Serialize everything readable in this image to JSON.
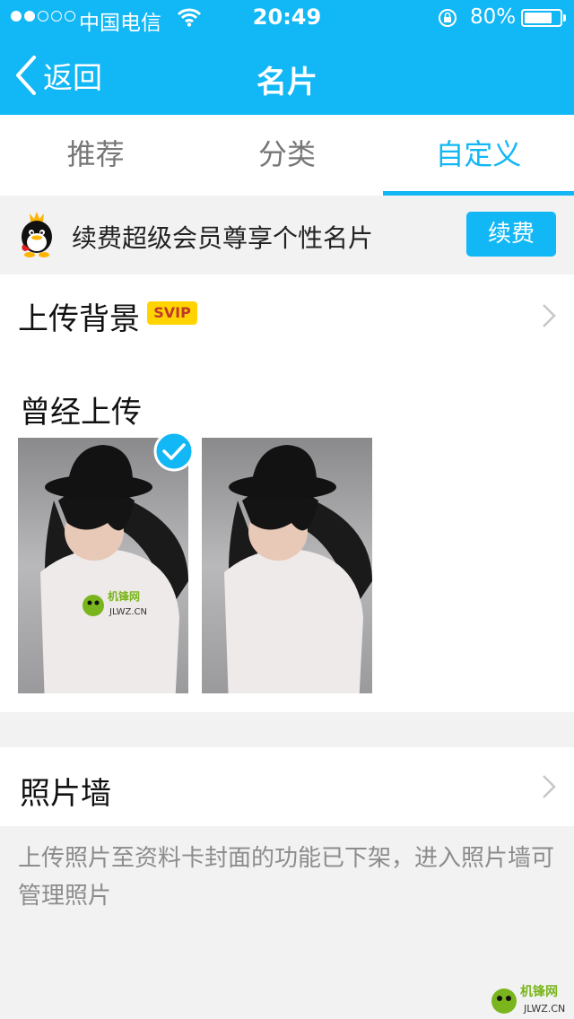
{
  "status_bar": {
    "carrier": "中国电信",
    "time": "20:49",
    "battery": "80%",
    "battery_level": 0.8
  },
  "nav": {
    "back_label": "返回",
    "title": "名片"
  },
  "tabs": [
    {
      "label": "推荐",
      "active": false
    },
    {
      "label": "分类",
      "active": false
    },
    {
      "label": "自定义",
      "active": true
    }
  ],
  "banner": {
    "text": "续费超级会员尊享个性名片",
    "button_label": "续费"
  },
  "upload": {
    "label": "上传背景",
    "badge": "SVIP",
    "history_label": "曾经上传"
  },
  "photos": [
    {
      "selected": true,
      "watermark": "JLWZ.CN"
    },
    {
      "selected": false
    }
  ],
  "photo_wall": {
    "label": "照片墙",
    "note": "上传照片至资料卡封面的功能已下架，进入照片墙可管理照片"
  },
  "watermark": {
    "text": "JLWZ.CN"
  },
  "colors": {
    "accent": "#12b7f5",
    "badge_bg": "#ffd400",
    "note_text": "#8c8c8c"
  }
}
